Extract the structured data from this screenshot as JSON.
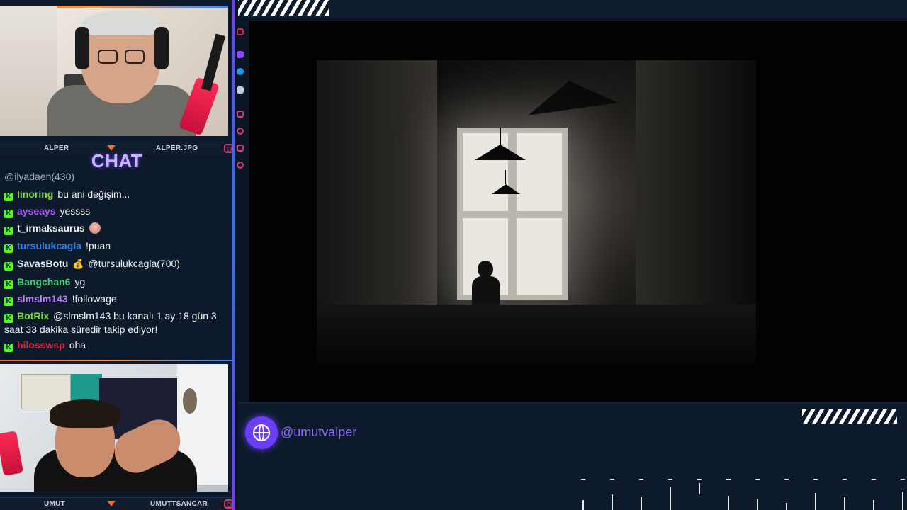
{
  "cams": {
    "top": {
      "name": "ALPER",
      "handle": "ALPER.JPG"
    },
    "bottom": {
      "name": "UMUT",
      "handle": "UMUTTSANCAR"
    }
  },
  "chat": {
    "title": "CHAT",
    "cut_line": "@ilyadaen(430)",
    "badge_letter": "K",
    "messages": [
      {
        "user": "linoring",
        "color": "#7ddc3f",
        "text": "bu ani değişim..."
      },
      {
        "user": "ayseays",
        "color": "#b25cff",
        "text": "yessss"
      },
      {
        "user": "t_irmaksaurus",
        "color": "#e9eef5",
        "text": "",
        "emote": "girl-emote"
      },
      {
        "user": "tursulukcagla",
        "color": "#2f7fe6",
        "text": "!puan"
      },
      {
        "user": "SavasBotu",
        "color": "#e9eef5",
        "text": "@tursulukcagla(700)",
        "emote": "money-bag-emote"
      },
      {
        "user": "Bangchan6",
        "color": "#3bd16f",
        "text": "yg"
      },
      {
        "user": "slmslm143",
        "color": "#c17bff",
        "text": "!followage"
      },
      {
        "user": "BotRix",
        "color": "#7ddc3f",
        "text": "@slmslm143 bu kanalı 1 ay 18 gün 3 saat 33 dakika süredir takip ediyor!"
      },
      {
        "user": "hilosswsp",
        "color": "#e0243a",
        "text": "oha"
      }
    ]
  },
  "footer": {
    "handle": "@umutvalper"
  },
  "colors": {
    "accent_purple": "#6b3dff",
    "accent_orange": "#ff6a1a",
    "kick_green": "#53fc18",
    "panel_bg": "#0d1a2b"
  },
  "social_icons": [
    "youtube-icon",
    "twitch-icon",
    "twitter-icon",
    "discord-icon",
    "instagram-icon",
    "tiktok-icon",
    "instagram-icon",
    "instagram-icon"
  ]
}
